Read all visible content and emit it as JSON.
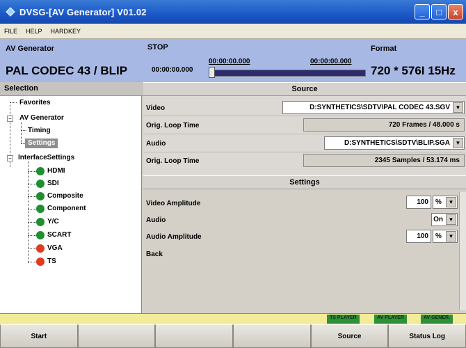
{
  "window": {
    "title": "DVSG-[AV Generator]  V01.02",
    "min_label": "_",
    "max_label": "□",
    "close_label": "x"
  },
  "menu": [
    "FILE",
    "HELP",
    "HARDKEY"
  ],
  "header": {
    "mode_label": "AV Generator",
    "mode_value": "PAL CODEC 43 / BLIP",
    "state": "STOP",
    "time_left": "00:00:00.000",
    "time_current": "00:00:00.000",
    "time_right": "00:00:00.000",
    "format_label": "Format",
    "format_value": "720 * 576I 15Hz",
    "playback_progress": 0
  },
  "selection": {
    "header": "Selection",
    "items": {
      "favorites": "Favorites",
      "av_generator": "AV Generator",
      "timing": "Timing",
      "settings": "Settings",
      "interface_settings": "InterfaceSettings",
      "hdmi": "HDMI",
      "sdi": "SDI",
      "composite": "Composite",
      "component": "Component",
      "yc": "Y/C",
      "scart": "SCART",
      "vga": "VGA",
      "ts": "TS"
    },
    "status_colors": {
      "hdmi": "#1f8f2f",
      "sdi": "#1f8f2f",
      "composite": "#1f8f2f",
      "component": "#1f8f2f",
      "yc": "#1f8f2f",
      "scart": "#1f8f2f",
      "vga": "#e23a1e",
      "ts": "#e23a1e"
    }
  },
  "source": {
    "header": "Source",
    "video_label": "Video",
    "video_value": "D:SYNTHETICS\\SDTV\\PAL CODEC 43.SGV",
    "video_loop_label": "Orig. Loop Time",
    "video_loop_value": "720 Frames / 48.000 s",
    "audio_label": "Audio",
    "audio_value": "D:SYNTHETICS\\SDTV\\BLIP.SGA",
    "audio_loop_label": "Orig. Loop Time",
    "audio_loop_value": "2345 Samples / 53.174 ms"
  },
  "settings": {
    "header": "Settings",
    "video_amplitude_label": "Video Amplitude",
    "video_amplitude_value": "100",
    "video_amplitude_unit": "%",
    "audio_label": "Audio",
    "audio_value": "On",
    "audio_amplitude_label": "Audio Amplitude",
    "audio_amplitude_value": "100",
    "audio_amplitude_unit": "%",
    "back_label": "Back"
  },
  "status_tags": [
    "TS PLAYER",
    "AV PLAYER",
    "AV GENER."
  ],
  "softkeys": [
    "Start",
    "",
    "",
    "",
    "Source",
    "Status Log"
  ]
}
